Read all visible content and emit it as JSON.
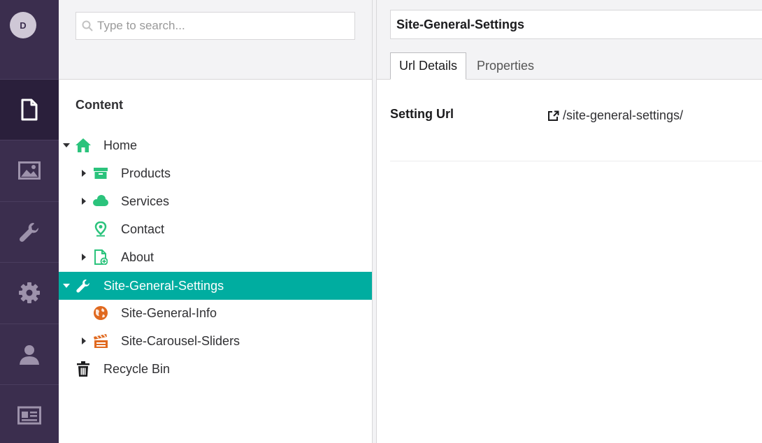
{
  "user": {
    "initial": "D"
  },
  "rail": {
    "items": [
      {
        "name": "content",
        "icon": "document-icon",
        "active": true
      },
      {
        "name": "media",
        "icon": "image-icon",
        "active": false
      },
      {
        "name": "settings",
        "icon": "wrench-icon",
        "active": false
      },
      {
        "name": "developer",
        "icon": "gear-icon",
        "active": false
      },
      {
        "name": "users",
        "icon": "user-icon",
        "active": false
      },
      {
        "name": "members",
        "icon": "id-card-icon",
        "active": false
      }
    ]
  },
  "search": {
    "placeholder": "Type to search...",
    "value": ""
  },
  "tree": {
    "title": "Content",
    "nodes": [
      {
        "label": "Home",
        "icon": "home-icon",
        "expanded": true
      },
      {
        "label": "Products",
        "icon": "archive-box-icon",
        "expanded": false
      },
      {
        "label": "Services",
        "icon": "cloud-icon",
        "expanded": false
      },
      {
        "label": "Contact",
        "icon": "map-pin-icon"
      },
      {
        "label": "About",
        "icon": "document-add-icon",
        "expanded": false
      },
      {
        "label": "Site-General-Settings",
        "icon": "wrench-icon",
        "expanded": true,
        "selected": true
      },
      {
        "label": "Site-General-Info",
        "icon": "globe-icon"
      },
      {
        "label": "Site-Carousel-Sliders",
        "icon": "clapperboard-icon",
        "expanded": false
      },
      {
        "label": "Recycle Bin",
        "icon": "trash-icon"
      }
    ]
  },
  "editor": {
    "name": "Site-General-Settings",
    "tabs": [
      {
        "label": "Url Details",
        "active": true
      },
      {
        "label": "Properties",
        "active": false
      }
    ],
    "properties": [
      {
        "label": "Setting Url",
        "value": "/site-general-settings/",
        "icon": "external-link-icon"
      }
    ]
  },
  "colors": {
    "rail": "#3b2e4e",
    "rail_active": "#2a1f3b",
    "selected_node": "#00ada0",
    "icon_green": "#2bc37c",
    "icon_orange": "#e0691f"
  }
}
